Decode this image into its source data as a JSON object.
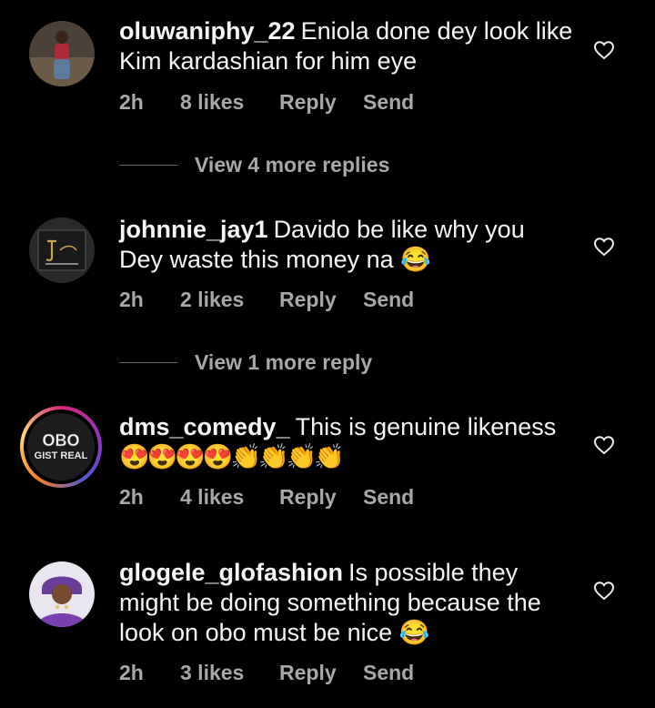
{
  "comments": [
    {
      "username": "oluwaniphy_22",
      "text": "Eniola done dey look like Kim kardashian for him eye",
      "time": "2h",
      "likes": "8 likes",
      "reply": "Reply",
      "send": "Send",
      "avatar": "person-photo",
      "liked": false
    },
    {
      "username": "johnnie_jay1",
      "text": "Davido be like why you Dey waste this money na",
      "emoji": "😂",
      "time": "2h",
      "likes": "2 likes",
      "reply": "Reply",
      "send": "Send",
      "avatar": "logo-dark",
      "liked": false
    },
    {
      "username": "dms_comedy_",
      "text": "This is genuine likeness",
      "emoji": "😍😍😍😍👏👏👏👏",
      "time": "2h",
      "likes": "4 likes",
      "reply": "Reply",
      "send": "Send",
      "avatar": "obo-gist-real-logo",
      "avatar_text_top": "OBO",
      "avatar_text_bottom": "GIST REAL",
      "has_story_ring": true,
      "liked": false
    },
    {
      "username": "glogele_glofashion",
      "text": "Is possible they might be doing something because the look on obo must be nice",
      "emoji": "😂",
      "time": "2h",
      "likes": "3 likes",
      "reply": "Reply",
      "send": "Send",
      "avatar": "person-photo-purple",
      "liked": false
    }
  ],
  "view_more": [
    {
      "label": "View 4 more replies"
    },
    {
      "label": "View 1 more reply"
    }
  ],
  "colors": {
    "background": "#000000",
    "primary_text": "#f5f5f5",
    "secondary_text": "#a8a8a8"
  },
  "icons": {
    "like": "heart-outline-icon"
  }
}
